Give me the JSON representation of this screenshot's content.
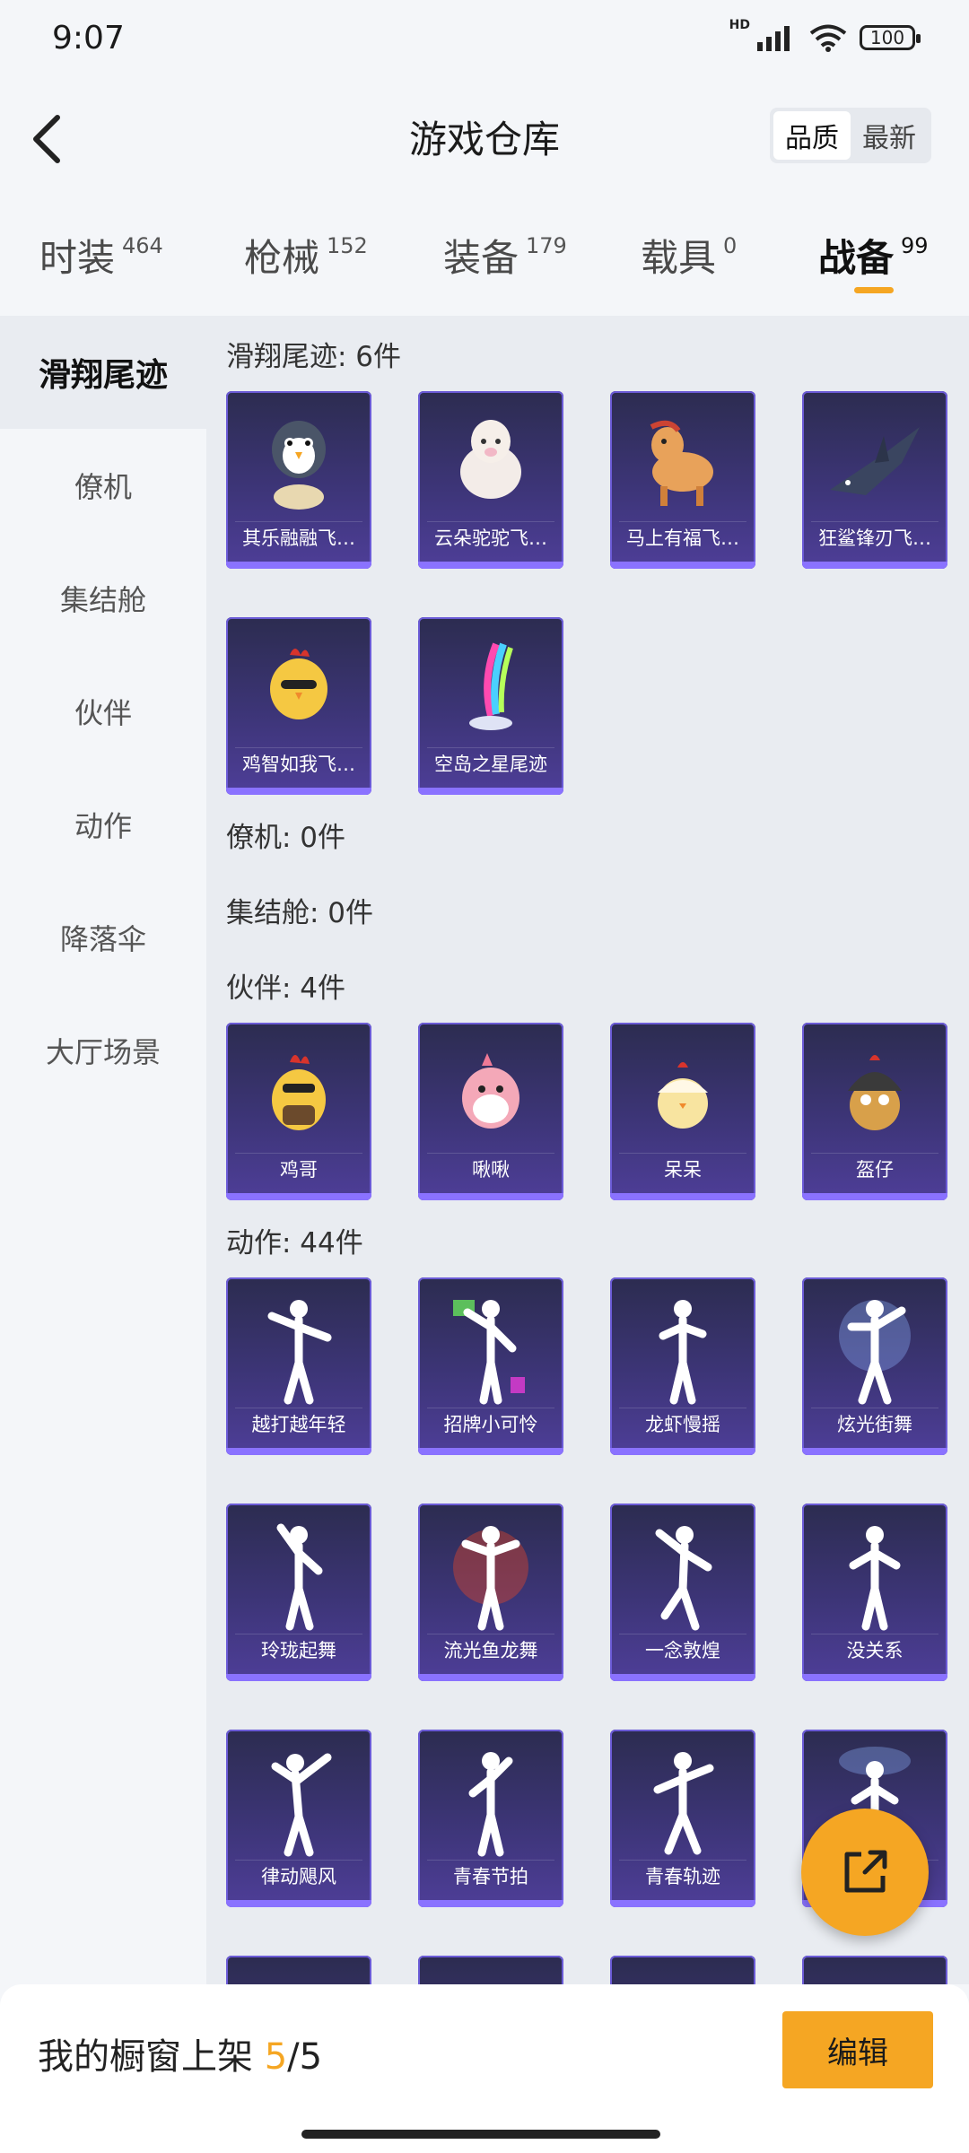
{
  "status": {
    "time": "9:07",
    "hd": "HD",
    "battery": "100"
  },
  "header": {
    "title": "游戏仓库",
    "sort_options": [
      "品质",
      "最新"
    ]
  },
  "tabs": [
    {
      "label": "时装",
      "count": "464"
    },
    {
      "label": "枪械",
      "count": "152"
    },
    {
      "label": "装备",
      "count": "179"
    },
    {
      "label": "载具",
      "count": "0"
    },
    {
      "label": "战备",
      "count": "99"
    }
  ],
  "sidebar": [
    "滑翔尾迹",
    "僚机",
    "集结舱",
    "伙伴",
    "动作",
    "降落伞",
    "大厅场景"
  ],
  "sections": {
    "glide": {
      "title": "滑翔尾迹: 6件",
      "items": [
        "其乐融融飞…",
        "云朵驼驼飞…",
        "马上有福飞…",
        "狂鲨锋刃飞…",
        "鸡智如我飞…",
        "空岛之星尾迹"
      ]
    },
    "wingman": {
      "title": "僚机: 0件"
    },
    "capsule": {
      "title": "集结舱: 0件"
    },
    "partner": {
      "title": "伙伴: 4件",
      "items": [
        "鸡哥",
        "啾啾",
        "呆呆",
        "盔仔"
      ]
    },
    "emote": {
      "title": "动作: 44件",
      "items": [
        "越打越年轻",
        "招牌小可怜",
        "龙虾慢摇",
        "炫光街舞",
        "玲珑起舞",
        "流光鱼龙舞",
        "一念敦煌",
        "没关系",
        "律动飓风",
        "青春节拍",
        "青春轨迹",
        ""
      ]
    }
  },
  "bottom": {
    "label": "我的橱窗上架 ",
    "count": "5",
    "total": "/5",
    "edit": "编辑"
  },
  "colors": {
    "accent": "#f5a623",
    "card": "#3d3578",
    "card_border": "#6b5bd6"
  },
  "icons": {
    "back": "chevron-left-icon",
    "share": "share-external-icon",
    "wifi": "wifi-icon",
    "signal": "signal-icon"
  }
}
